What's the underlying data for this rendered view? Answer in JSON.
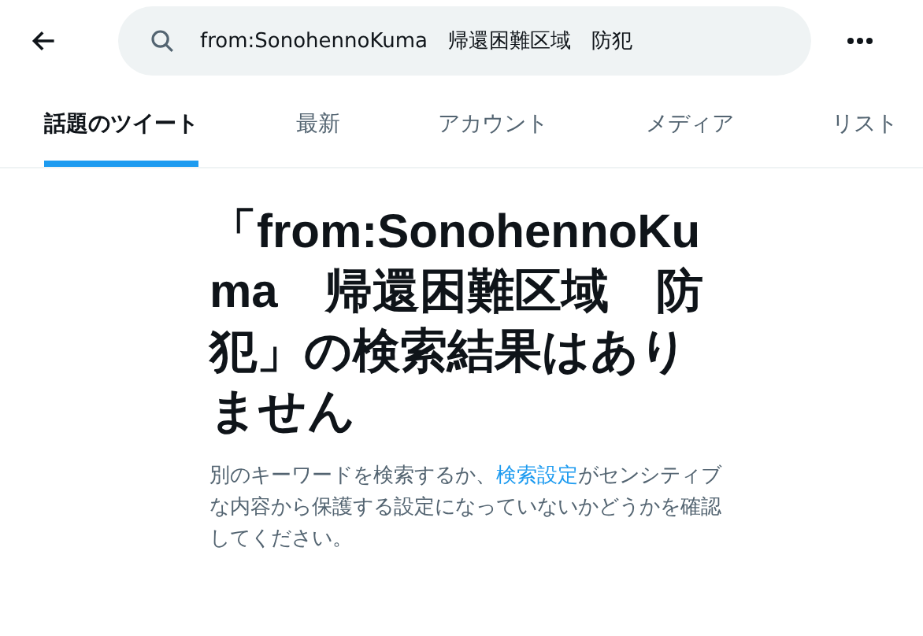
{
  "search": {
    "value": "from:SonohennoKuma　帰還困難区域　防犯"
  },
  "tabs": [
    {
      "label": "話題のツイート",
      "selected": true
    },
    {
      "label": "最新",
      "selected": false
    },
    {
      "label": "アカウント",
      "selected": false
    },
    {
      "label": "メディア",
      "selected": false
    },
    {
      "label": "リスト",
      "selected": false
    }
  ],
  "empty_state": {
    "title": "「from:SonohennoKuma　帰還困難区域　防犯」の検索結果はありません",
    "text_before": "別のキーワードを検索するか、",
    "link": "検索設定",
    "text_after": "がセンシティブな内容から保護する設定になっていないかどうかを確認してください。"
  }
}
